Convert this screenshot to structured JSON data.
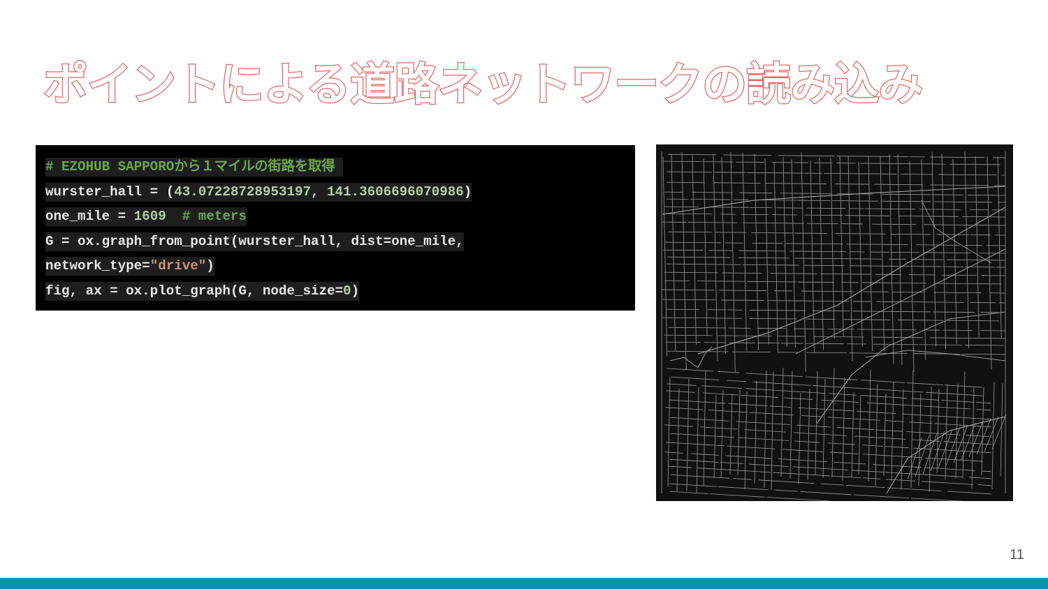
{
  "slide": {
    "title": "ポイントによる道路ネットワークの読み込み",
    "page_number": "11"
  },
  "code": {
    "lines": [
      [
        {
          "t": "# EZOHUB SAPPOROから１マイルの街路を取得 ",
          "c": "comment"
        }
      ],
      [
        {
          "t": "wurster_hall = (",
          "c": "plain"
        },
        {
          "t": "43.07228728953197",
          "c": "number"
        },
        {
          "t": ", ",
          "c": "plain"
        },
        {
          "t": "141.3606696070986",
          "c": "number"
        },
        {
          "t": ")",
          "c": "plain"
        }
      ],
      [
        {
          "t": "one_mile = ",
          "c": "plain"
        },
        {
          "t": "1609",
          "c": "number"
        },
        {
          "t": "  ",
          "c": "plain"
        },
        {
          "t": "# meters",
          "c": "comment"
        }
      ],
      [
        {
          "t": "G = ox.graph_from_point(wurster_hall, dist=one_mile,",
          "c": "plain"
        }
      ],
      [
        {
          "t": "network_type=",
          "c": "plain"
        },
        {
          "t": "\"drive\"",
          "c": "string"
        },
        {
          "t": ")",
          "c": "plain"
        }
      ],
      [
        {
          "t": "fig, ax = ox.plot_graph(G, node_size=",
          "c": "plain"
        },
        {
          "t": "0",
          "c": "number"
        },
        {
          "t": ")",
          "c": "plain"
        }
      ]
    ]
  },
  "map": {
    "description_icon": "street-network-plot",
    "background_color": "#111111",
    "edge_color": "#9a9a9a"
  },
  "colors": {
    "title": "#e06666",
    "footer": "#0e8fb5",
    "comment": "#6aa84f",
    "number": "#b5cea8",
    "string": "#ce9178"
  }
}
